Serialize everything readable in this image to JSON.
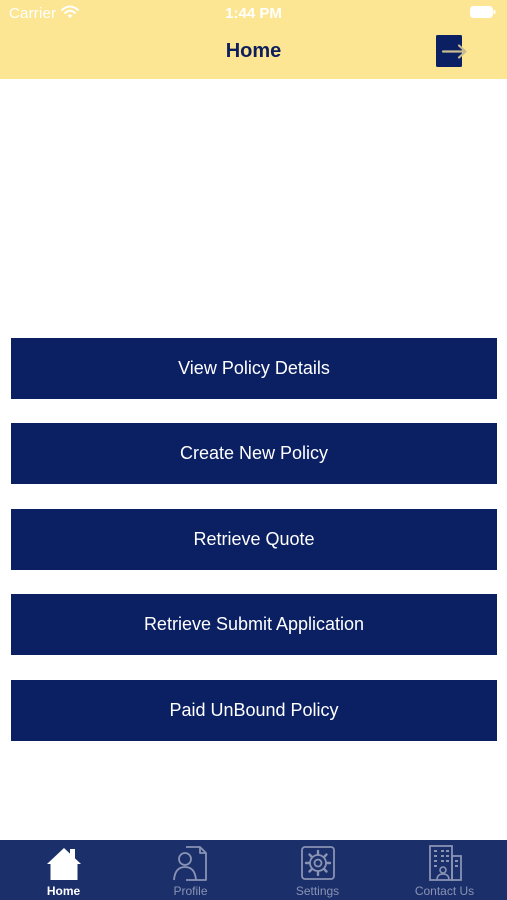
{
  "status_bar": {
    "carrier": "Carrier",
    "time": "1:44 PM"
  },
  "nav": {
    "title": "Home",
    "logout_icon": "logout-exit-icon"
  },
  "menu": [
    {
      "label": "View Policy Details"
    },
    {
      "label": "Create New Policy"
    },
    {
      "label": "Retrieve Quote"
    },
    {
      "label": "Retrieve Submit Application"
    },
    {
      "label": "Paid UnBound Policy"
    }
  ],
  "tabs": [
    {
      "label": "Home",
      "icon": "home-icon",
      "active": true
    },
    {
      "label": "Profile",
      "icon": "profile-document-icon",
      "active": false
    },
    {
      "label": "Settings",
      "icon": "settings-gear-icon",
      "active": false
    },
    {
      "label": "Contact Us",
      "icon": "contact-building-icon",
      "active": false
    }
  ],
  "colors": {
    "header_bg": "#fce693",
    "title_text": "#0f1f5c",
    "button_bg": "#0b1f63",
    "tab_bar_bg": "#1b2f6b",
    "tab_active": "#ffffff",
    "tab_inactive": "#8a93b3"
  }
}
